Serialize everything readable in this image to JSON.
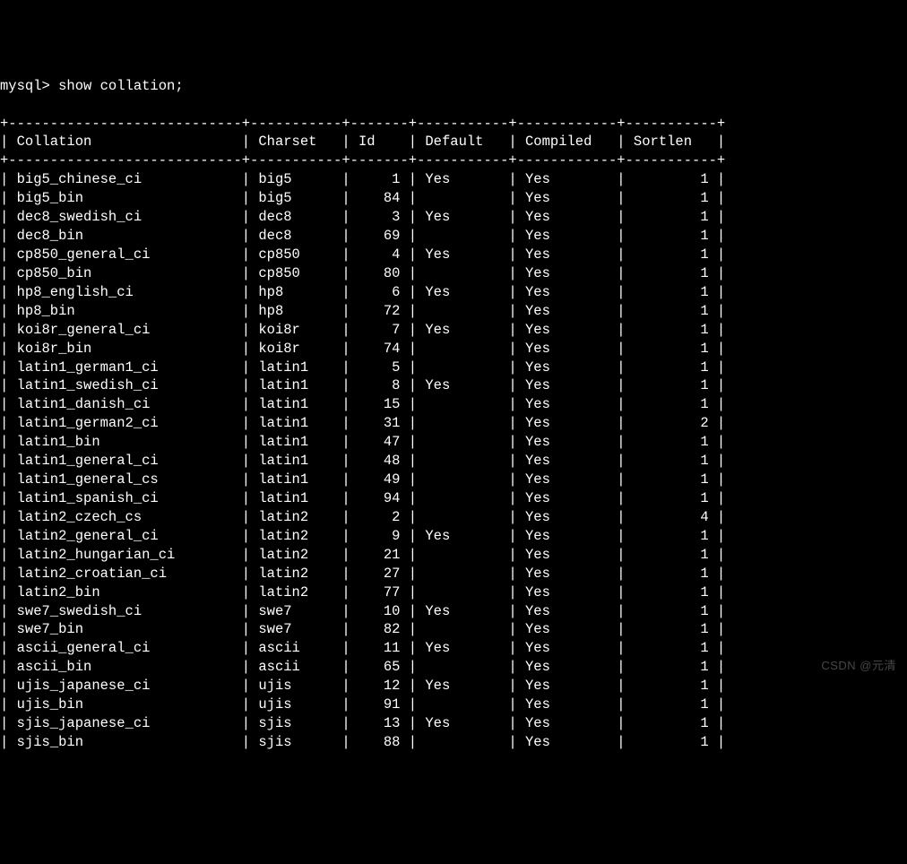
{
  "prompt": "mysql> show collation;",
  "col_widths": {
    "collation": 26,
    "charset": 9,
    "id": 5,
    "default": 9,
    "compiled": 10,
    "sortlen": 9
  },
  "headers": {
    "collation": "Collation",
    "charset": "Charset",
    "id": "Id",
    "default": "Default",
    "compiled": "Compiled",
    "sortlen": "Sortlen"
  },
  "rows": [
    {
      "collation": "big5_chinese_ci",
      "charset": "big5",
      "id": 1,
      "default": "Yes",
      "compiled": "Yes",
      "sortlen": 1
    },
    {
      "collation": "big5_bin",
      "charset": "big5",
      "id": 84,
      "default": "",
      "compiled": "Yes",
      "sortlen": 1
    },
    {
      "collation": "dec8_swedish_ci",
      "charset": "dec8",
      "id": 3,
      "default": "Yes",
      "compiled": "Yes",
      "sortlen": 1
    },
    {
      "collation": "dec8_bin",
      "charset": "dec8",
      "id": 69,
      "default": "",
      "compiled": "Yes",
      "sortlen": 1
    },
    {
      "collation": "cp850_general_ci",
      "charset": "cp850",
      "id": 4,
      "default": "Yes",
      "compiled": "Yes",
      "sortlen": 1
    },
    {
      "collation": "cp850_bin",
      "charset": "cp850",
      "id": 80,
      "default": "",
      "compiled": "Yes",
      "sortlen": 1
    },
    {
      "collation": "hp8_english_ci",
      "charset": "hp8",
      "id": 6,
      "default": "Yes",
      "compiled": "Yes",
      "sortlen": 1
    },
    {
      "collation": "hp8_bin",
      "charset": "hp8",
      "id": 72,
      "default": "",
      "compiled": "Yes",
      "sortlen": 1
    },
    {
      "collation": "koi8r_general_ci",
      "charset": "koi8r",
      "id": 7,
      "default": "Yes",
      "compiled": "Yes",
      "sortlen": 1
    },
    {
      "collation": "koi8r_bin",
      "charset": "koi8r",
      "id": 74,
      "default": "",
      "compiled": "Yes",
      "sortlen": 1
    },
    {
      "collation": "latin1_german1_ci",
      "charset": "latin1",
      "id": 5,
      "default": "",
      "compiled": "Yes",
      "sortlen": 1
    },
    {
      "collation": "latin1_swedish_ci",
      "charset": "latin1",
      "id": 8,
      "default": "Yes",
      "compiled": "Yes",
      "sortlen": 1
    },
    {
      "collation": "latin1_danish_ci",
      "charset": "latin1",
      "id": 15,
      "default": "",
      "compiled": "Yes",
      "sortlen": 1
    },
    {
      "collation": "latin1_german2_ci",
      "charset": "latin1",
      "id": 31,
      "default": "",
      "compiled": "Yes",
      "sortlen": 2
    },
    {
      "collation": "latin1_bin",
      "charset": "latin1",
      "id": 47,
      "default": "",
      "compiled": "Yes",
      "sortlen": 1
    },
    {
      "collation": "latin1_general_ci",
      "charset": "latin1",
      "id": 48,
      "default": "",
      "compiled": "Yes",
      "sortlen": 1
    },
    {
      "collation": "latin1_general_cs",
      "charset": "latin1",
      "id": 49,
      "default": "",
      "compiled": "Yes",
      "sortlen": 1
    },
    {
      "collation": "latin1_spanish_ci",
      "charset": "latin1",
      "id": 94,
      "default": "",
      "compiled": "Yes",
      "sortlen": 1
    },
    {
      "collation": "latin2_czech_cs",
      "charset": "latin2",
      "id": 2,
      "default": "",
      "compiled": "Yes",
      "sortlen": 4
    },
    {
      "collation": "latin2_general_ci",
      "charset": "latin2",
      "id": 9,
      "default": "Yes",
      "compiled": "Yes",
      "sortlen": 1
    },
    {
      "collation": "latin2_hungarian_ci",
      "charset": "latin2",
      "id": 21,
      "default": "",
      "compiled": "Yes",
      "sortlen": 1
    },
    {
      "collation": "latin2_croatian_ci",
      "charset": "latin2",
      "id": 27,
      "default": "",
      "compiled": "Yes",
      "sortlen": 1
    },
    {
      "collation": "latin2_bin",
      "charset": "latin2",
      "id": 77,
      "default": "",
      "compiled": "Yes",
      "sortlen": 1
    },
    {
      "collation": "swe7_swedish_ci",
      "charset": "swe7",
      "id": 10,
      "default": "Yes",
      "compiled": "Yes",
      "sortlen": 1
    },
    {
      "collation": "swe7_bin",
      "charset": "swe7",
      "id": 82,
      "default": "",
      "compiled": "Yes",
      "sortlen": 1
    },
    {
      "collation": "ascii_general_ci",
      "charset": "ascii",
      "id": 11,
      "default": "Yes",
      "compiled": "Yes",
      "sortlen": 1
    },
    {
      "collation": "ascii_bin",
      "charset": "ascii",
      "id": 65,
      "default": "",
      "compiled": "Yes",
      "sortlen": 1
    },
    {
      "collation": "ujis_japanese_ci",
      "charset": "ujis",
      "id": 12,
      "default": "Yes",
      "compiled": "Yes",
      "sortlen": 1
    },
    {
      "collation": "ujis_bin",
      "charset": "ujis",
      "id": 91,
      "default": "",
      "compiled": "Yes",
      "sortlen": 1
    },
    {
      "collation": "sjis_japanese_ci",
      "charset": "sjis",
      "id": 13,
      "default": "Yes",
      "compiled": "Yes",
      "sortlen": 1
    },
    {
      "collation": "sjis_bin",
      "charset": "sjis",
      "id": 88,
      "default": "",
      "compiled": "Yes",
      "sortlen": 1
    }
  ],
  "watermark": "CSDN @元清"
}
